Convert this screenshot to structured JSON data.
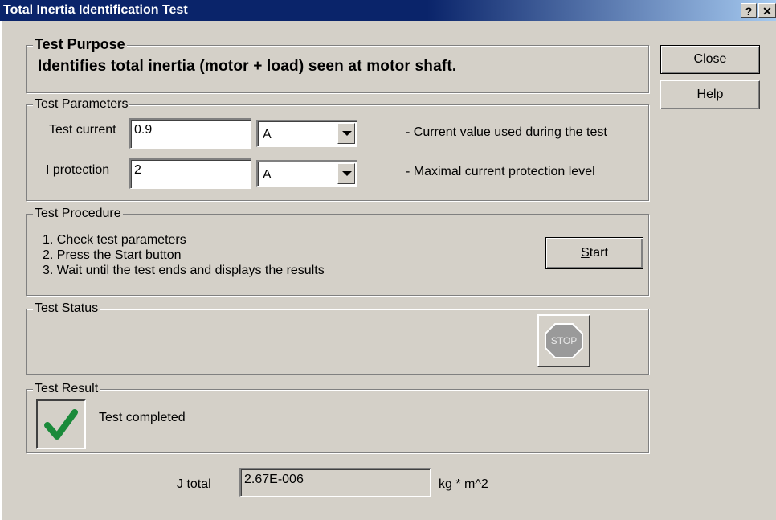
{
  "window": {
    "title": "Total Inertia Identification Test",
    "help_glyph": "?",
    "close_glyph": "✕"
  },
  "side_buttons": {
    "close_label": "Close",
    "help_label": "Help"
  },
  "purpose": {
    "legend": "Test Purpose",
    "text": "Identifies total inertia (motor + load) seen at motor shaft."
  },
  "parameters": {
    "legend": "Test Parameters",
    "test_current": {
      "label": "Test current",
      "value": "0.9",
      "unit": "A",
      "description": "- Current value used during the test"
    },
    "i_protection": {
      "label": "I protection",
      "value": "2",
      "unit": "A",
      "description": "- Maximal current protection level"
    }
  },
  "procedure": {
    "legend": "Test Procedure",
    "steps": [
      "1. Check test parameters",
      "2. Press the Start button",
      "3. Wait until the test ends and displays the results"
    ],
    "start_mnemonic": "S",
    "start_rest": "tart"
  },
  "status": {
    "legend": "Test Status",
    "stop_icon_text": "STOP",
    "stop_color": "#9a9a9a"
  },
  "result": {
    "legend": "Test Result",
    "text": "Test completed",
    "check_color": "#1a8a3a"
  },
  "output": {
    "label": "J total",
    "value": "2.67E-006",
    "unit": "kg * m^2"
  }
}
